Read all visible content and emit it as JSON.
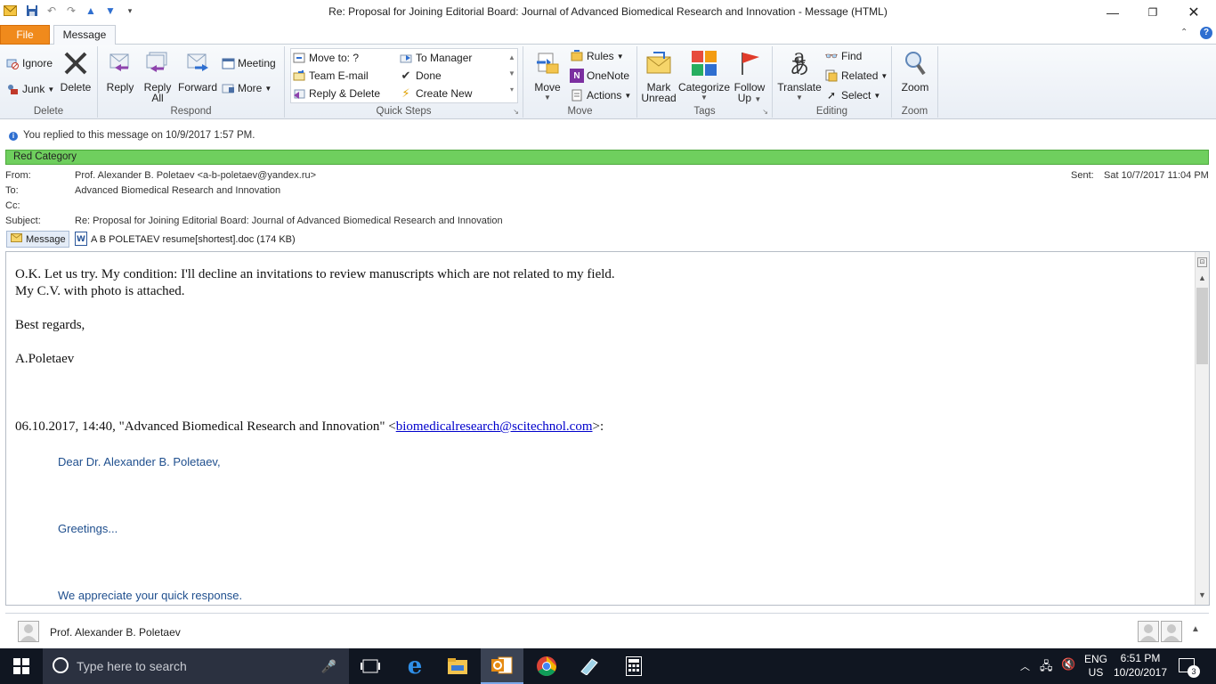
{
  "window": {
    "title": "Re: Proposal for Joining Editorial Board: Journal of Advanced Biomedical Research and Innovation  -  Message (HTML)"
  },
  "tabs": {
    "file": "File",
    "message": "Message"
  },
  "ribbon": {
    "delete_group": {
      "ignore": "Ignore",
      "junk": "Junk",
      "delete": "Delete",
      "name": "Delete"
    },
    "respond_group": {
      "reply": "Reply",
      "reply_all_line1": "Reply",
      "reply_all_line2": "All",
      "forward": "Forward",
      "meeting": "Meeting",
      "more": "More",
      "name": "Respond"
    },
    "quicksteps_group": {
      "move_to": "Move to: ?",
      "team_email": "Team E-mail",
      "reply_delete": "Reply & Delete",
      "to_manager": "To Manager",
      "done": "Done",
      "create_new": "Create New",
      "name": "Quick Steps"
    },
    "move_group": {
      "move": "Move",
      "rules": "Rules",
      "onenote": "OneNote",
      "actions": "Actions",
      "name": "Move"
    },
    "tags_group": {
      "mark_unread_line1": "Mark",
      "mark_unread_line2": "Unread",
      "categorize": "Categorize",
      "follow_up_line1": "Follow",
      "follow_up_line2": "Up",
      "name": "Tags"
    },
    "editing_group": {
      "translate": "Translate",
      "find": "Find",
      "related": "Related",
      "select": "Select",
      "name": "Editing"
    },
    "zoom_group": {
      "zoom": "Zoom",
      "name": "Zoom"
    }
  },
  "info": {
    "replied": "You replied to this message on 10/9/2017 1:57 PM.",
    "category": "Red Category"
  },
  "header": {
    "from_label": "From:",
    "from_value": "Prof. Alexander B. Poletaev <a-b-poletaev@yandex.ru>",
    "to_label": "To:",
    "to_value": "Advanced Biomedical Research and Innovation",
    "cc_label": "Cc:",
    "subject_label": "Subject:",
    "subject_value": "Re: Proposal for Joining Editorial Board: Journal of Advanced Biomedical Research and Innovation",
    "sent_label": "Sent:",
    "sent_value": "Sat 10/7/2017 11:04 PM"
  },
  "attachments": {
    "message_tab": "Message",
    "file": "A B POLETAEV resume[shortest].doc (174 KB)"
  },
  "body": {
    "line1": "O.K. Let us try. My condition: I'll decline an invitations to review manuscripts which are not related to my field.",
    "line2": "My C.V. with photo is attached.",
    "regards": "Best regards,",
    "signature": "A.Poletaev",
    "quote_header_pre": "06.10.2017, 14:40, \"Advanced Biomedical Research and Innovation\" <",
    "quote_header_link": "biomedicalresearch@scitechnol.com",
    "quote_header_post": ">:",
    "quote_greeting": "Dear Dr. Alexander B. Poletaev,",
    "quote_greetings": "Greetings...",
    "quote_appreciate": "We appreciate your quick response."
  },
  "people": {
    "name": "Prof. Alexander B. Poletaev"
  },
  "taskbar": {
    "search_placeholder": "Type here to search",
    "lang1": "ENG",
    "lang2": "US",
    "time": "6:51 PM",
    "date": "10/20/2017",
    "notifications": "3"
  }
}
